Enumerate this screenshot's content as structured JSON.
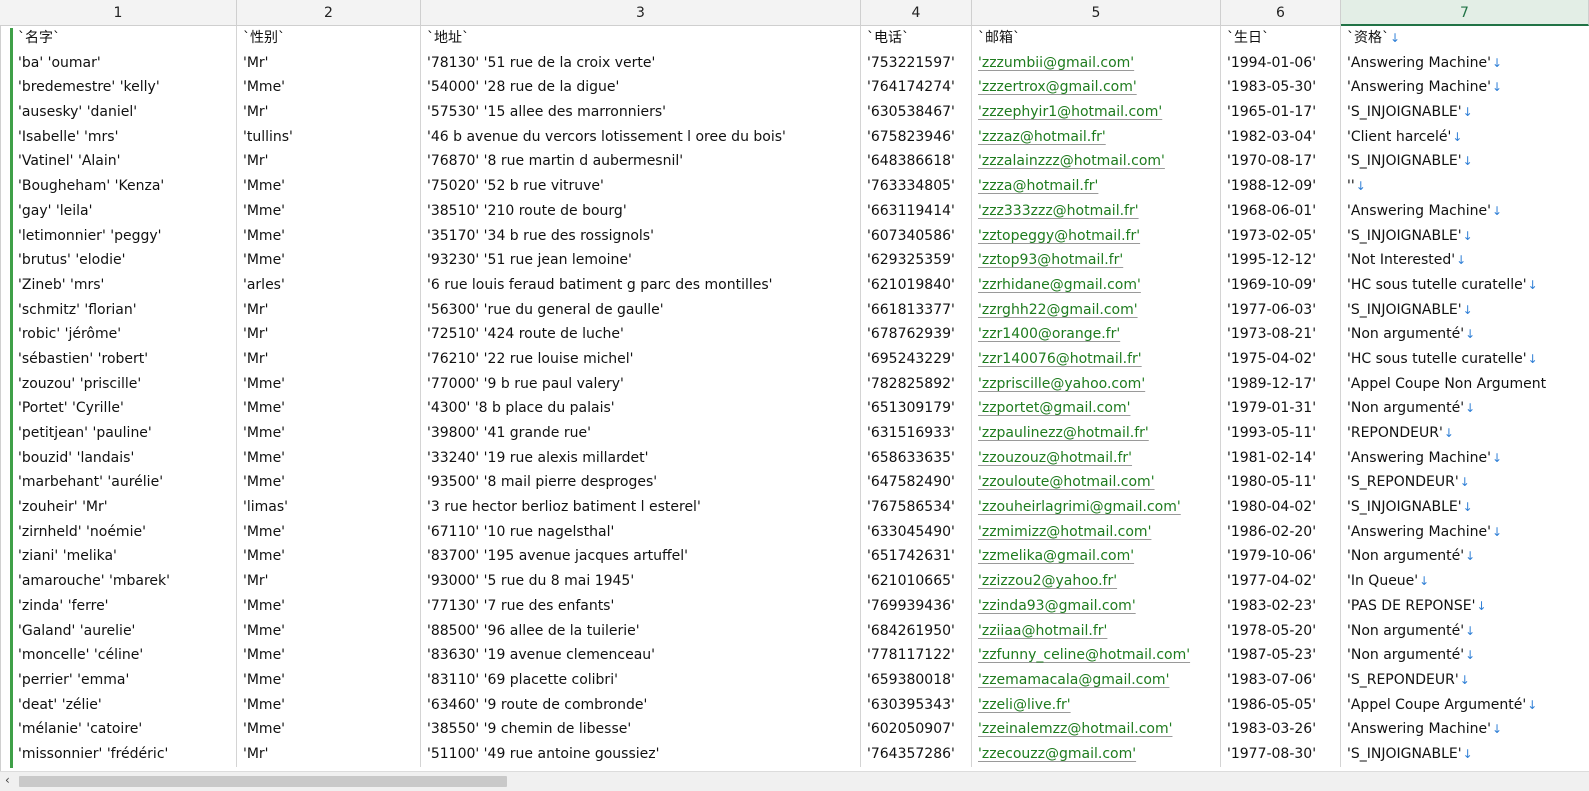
{
  "columns": [
    "1",
    "2",
    "3",
    "4",
    "5",
    "6",
    "7"
  ],
  "active_column_index": 6,
  "header_row": [
    "`名字`",
    "`性别`",
    "`地址`",
    "`电话`",
    "`邮箱`",
    "`生日`",
    "`资格`"
  ],
  "rows": [
    [
      "'ba' 'oumar'",
      "'Mr'",
      "'78130' '51 rue de la croix verte'",
      "'753221597'",
      "'zzzumbii@gmail.com'",
      "'1994-01-06'",
      "'Answering Machine'"
    ],
    [
      "'bredemestre' 'kelly'",
      "'Mme'",
      "'54000' '28 rue de la digue'",
      "'764174274'",
      "'zzzertrox@gmail.com'",
      "'1983-05-30'",
      "'Answering Machine'"
    ],
    [
      "'ausesky' 'daniel'",
      "'Mr'",
      "'57530' '15 allee des marronniers'",
      "'630538467'",
      "'zzzephyir1@hotmail.com'",
      "'1965-01-17'",
      "'S_INJOIGNABLE'"
    ],
    [
      "'Isabelle' 'mrs'",
      "'tullins'",
      "'46 b avenue du vercors lotissement l oree du bois'",
      "'675823946'",
      "'zzzaz@hotmail.fr'",
      "'1982-03-04'",
      "'Client harcelé'"
    ],
    [
      "'Vatinel' 'Alain'",
      "'Mr'",
      "'76870' '8 rue martin d aubermesnil'",
      "'648386618'",
      "'zzzalainzzz@hotmail.com'",
      "'1970-08-17'",
      "'S_INJOIGNABLE'"
    ],
    [
      "'Bougheham' 'Kenza'",
      "'Mme'",
      "'75020' '52 b rue vitruve'",
      "'763334805'",
      "'zzza@hotmail.fr'",
      "'1988-12-09'",
      "''"
    ],
    [
      "'gay' 'leila'",
      "'Mme'",
      "'38510' '210 route de bourg'",
      "'663119414'",
      "'zzz333zzz@hotmail.fr'",
      "'1968-06-01'",
      "'Answering Machine'"
    ],
    [
      "'letimonnier' 'peggy'",
      "'Mme'",
      "'35170' '34 b rue des rossignols'",
      "'607340586'",
      "'zztopeggy@hotmail.fr'",
      "'1973-02-05'",
      "'S_INJOIGNABLE'"
    ],
    [
      "'brutus' 'elodie'",
      "'Mme'",
      "'93230' '51 rue jean lemoine'",
      "'629325359'",
      "'zztop93@hotmail.fr'",
      "'1995-12-12'",
      "'Not Interested'"
    ],
    [
      "'Zineb' 'mrs'",
      "'arles'",
      "'6 rue louis feraud batiment g parc des montilles'",
      "'621019840'",
      "'zzrhidane@gmail.com'",
      "'1969-10-09'",
      "'HC sous tutelle curatelle'"
    ],
    [
      "'schmitz' 'florian'",
      "'Mr'",
      "'56300' 'rue du general de gaulle'",
      "'661813377'",
      "'zzrghh22@gmail.com'",
      "'1977-06-03'",
      "'S_INJOIGNABLE'"
    ],
    [
      "'robic' 'jérôme'",
      "'Mr'",
      "'72510' '424 route de luche'",
      "'678762939'",
      "'zzr1400@orange.fr'",
      "'1973-08-21'",
      "'Non argumenté'"
    ],
    [
      "'sébastien' 'robert'",
      "'Mr'",
      "'76210' '22 rue louise michel'",
      "'695243229'",
      "'zzr140076@hotmail.fr'",
      "'1975-04-02'",
      "'HC sous tutelle curatelle'"
    ],
    [
      "'zouzou' 'priscille'",
      "'Mme'",
      "'77000' '9 b rue paul valery'",
      "'782825892'",
      "'zzpriscille@yahoo.com'",
      "'1989-12-17'",
      "'Appel Coupe Non Argument"
    ],
    [
      "'Portet' 'Cyrille'",
      "'Mme'",
      "'4300' '8 b place du palais'",
      "'651309179'",
      "'zzportet@gmail.com'",
      "'1979-01-31'",
      "'Non argumenté'"
    ],
    [
      "'petitjean' 'pauline'",
      "'Mme'",
      "'39800' '41 grande rue'",
      "'631516933'",
      "'zzpaulinezz@hotmail.fr'",
      "'1993-05-11'",
      "'REPONDEUR'"
    ],
    [
      "'bouzid' 'landais'",
      "'Mme'",
      "'33240' '19 rue alexis millardet'",
      "'658633635'",
      "'zzouzouz@hotmail.fr'",
      "'1981-02-14'",
      "'Answering Machine'"
    ],
    [
      "'marbehant' 'aurélie'",
      "'Mme'",
      "'93500' '8 mail pierre desproges'",
      "'647582490'",
      "'zzouloute@hotmail.com'",
      "'1980-05-11'",
      "'S_REPONDEUR'"
    ],
    [
      "'zouheir' 'Mr'",
      "'limas'",
      "'3 rue hector berlioz batiment l esterel'",
      "'767586534'",
      "'zzouheirlagrimi@gmail.com'",
      "'1980-04-02'",
      "'S_INJOIGNABLE'"
    ],
    [
      "'zirnheld' 'noémie'",
      "'Mme'",
      "'67110' '10 rue nagelsthal'",
      "'633045490'",
      "'zzmimizz@hotmail.com'",
      "'1986-02-20'",
      "'Answering Machine'"
    ],
    [
      "'ziani' 'melika'",
      "'Mme'",
      "'83700' '195 avenue jacques artuffel'",
      "'651742631'",
      "'zzmelika@gmail.com'",
      "'1979-10-06'",
      "'Non argumenté'"
    ],
    [
      "'amarouche' 'mbarek'",
      "'Mr'",
      "'93000' '5 rue du 8 mai 1945'",
      "'621010665'",
      "'zzizzou2@yahoo.fr'",
      "'1977-04-02'",
      "'In Queue'"
    ],
    [
      "'zinda' 'ferre'",
      "'Mme'",
      "'77130' '7 rue des enfants'",
      "'769939436'",
      "'zzinda93@gmail.com'",
      "'1983-02-23'",
      "'PAS DE REPONSE'"
    ],
    [
      "'Galand' 'aurelie'",
      "'Mme'",
      "'88500' '96 allee de la tuilerie'",
      "'684261950'",
      "'zziiaa@hotmail.fr'",
      "'1978-05-20'",
      "'Non argumenté'"
    ],
    [
      "'moncelle' 'céline'",
      "'Mme'",
      "'83630' '19 avenue clemenceau'",
      "'778117122'",
      "'zzfunny_celine@hotmail.com'",
      "'1987-05-23'",
      "'Non argumenté'"
    ],
    [
      "'perrier' 'emma'",
      "'Mme'",
      "'83110' '69 placette colibri'",
      "'659380018'",
      "'zzemamacala@gmail.com'",
      "'1983-07-06'",
      "'S_REPONDEUR'"
    ],
    [
      "'deat' 'zélie'",
      "'Mme'",
      "'63460' '9 route de combronde'",
      "'630395343'",
      "'zzeli@live.fr'",
      "'1986-05-05'",
      "'Appel Coupe Argumenté'"
    ],
    [
      "'mélanie' 'catoire'",
      "'Mme'",
      "'38550' '9 chemin de libesse'",
      "'602050907'",
      "'zzeinalemzz@hotmail.com'",
      "'1983-03-26'",
      "'Answering Machine'"
    ],
    [
      "'missonnier' 'frédéric'",
      "'Mr'",
      "'51100' '49 rue antoine goussiez'",
      "'764357286'",
      "'zzecouzz@gmail.com'",
      "'1977-08-30'",
      "'S_INJOIGNABLE'"
    ]
  ],
  "newline_marker": "↓",
  "scroll_left_arrow": "‹",
  "colors": {
    "email": "#1e7b1e",
    "arrow": "#2f7fd6",
    "active_header": "#217346",
    "row_marker": "#3fa048"
  }
}
